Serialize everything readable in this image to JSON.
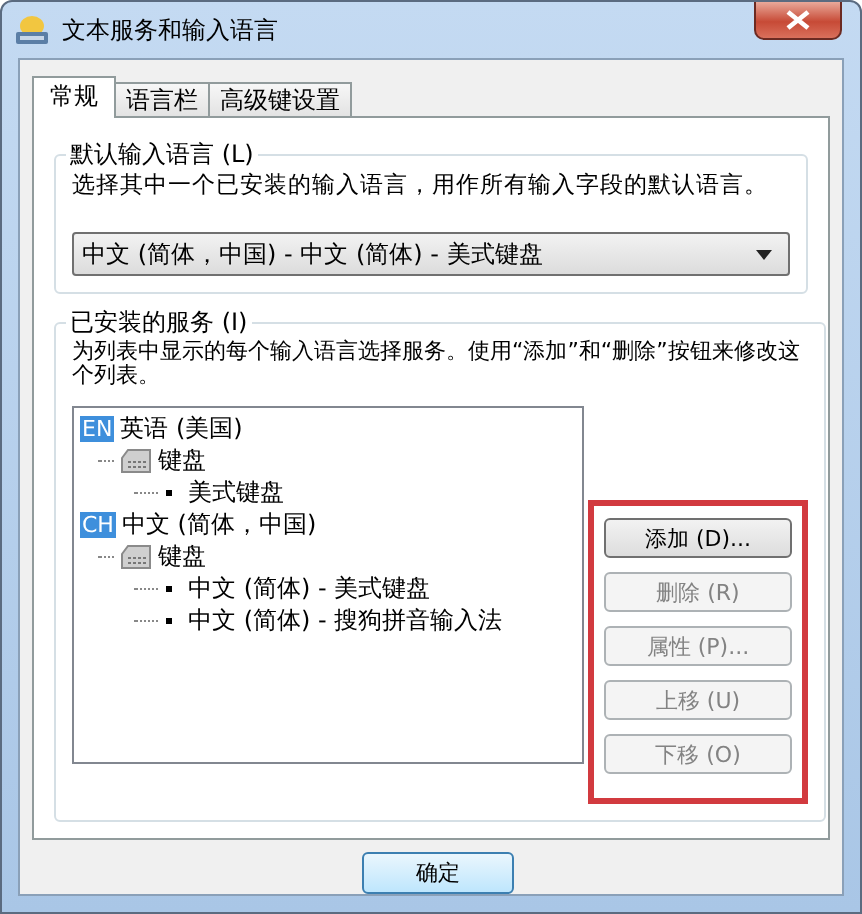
{
  "window": {
    "title": "文本服务和输入语言"
  },
  "tabs": [
    {
      "label": "常规",
      "selected": true
    },
    {
      "label": "语言栏",
      "selected": false
    },
    {
      "label": "高级键设置",
      "selected": false
    }
  ],
  "default_language": {
    "legend": "默认输入语言 (L)",
    "description": "选择其中一个已安装的输入语言，用作所有输入字段的默认语言。",
    "value": "中文 (简体，中国) - 中文 (简体) - 美式键盘"
  },
  "installed_services": {
    "legend": "已安装的服务 (I)",
    "description": "为列表中显示的每个输入语言选择服务。使用“添加”和“删除”按钮来修改这个列表。",
    "tree": [
      {
        "badge": "EN",
        "label": "英语 (美国)",
        "children": [
          {
            "label": "键盘",
            "children": [
              {
                "label": "美式键盘"
              }
            ]
          }
        ]
      },
      {
        "badge": "CH",
        "label": "中文 (简体，中国)",
        "children": [
          {
            "label": "键盘",
            "children": [
              {
                "label": "中文 (简体) - 美式键盘"
              },
              {
                "label": "中文 (简体) - 搜狗拼音输入法"
              }
            ]
          }
        ]
      }
    ],
    "buttons": [
      {
        "label": "添加 (D)...",
        "disabled": false
      },
      {
        "label": "删除 (R)",
        "disabled": true
      },
      {
        "label": "属性 (P)...",
        "disabled": true
      },
      {
        "label": "上移 (U)",
        "disabled": true
      },
      {
        "label": "下移 (O)",
        "disabled": true
      }
    ],
    "highlighted": true
  },
  "footer_buttons": [
    {
      "label": "确定",
      "disabled": false
    }
  ]
}
